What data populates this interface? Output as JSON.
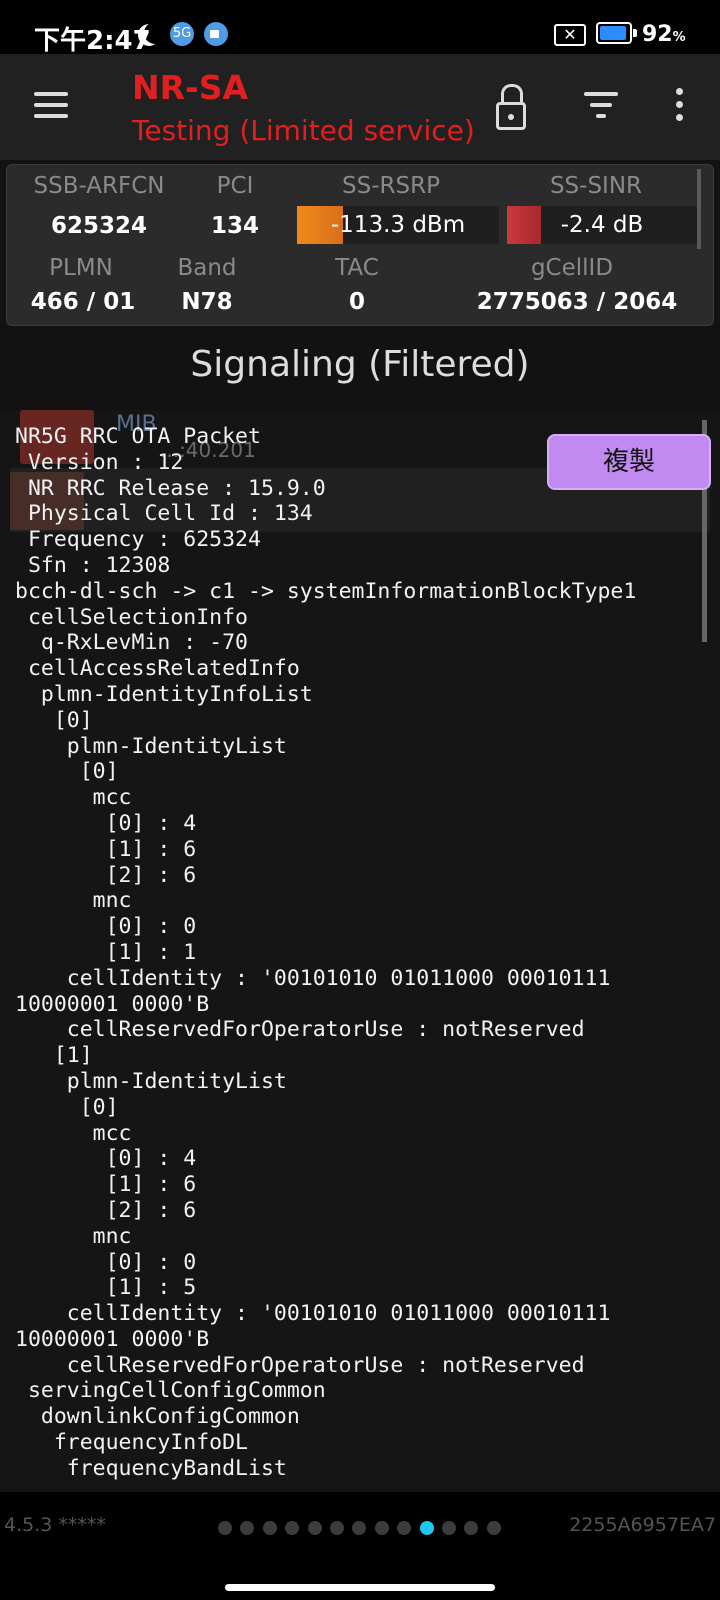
{
  "status_bar": {
    "time": "下午2:47",
    "battery_pct": "92",
    "battery_unit": "%",
    "wifi_badge": "5G"
  },
  "app_bar": {
    "title": "NR-SA",
    "subtitle": "Testing (Limited service)",
    "icons": [
      "menu-icon",
      "lock-icon",
      "filter-icon",
      "more-vert-icon"
    ],
    "accent_color": "#e11f1f"
  },
  "cell_info": {
    "labels": {
      "ssb_arfcn": "SSB-ARFCN",
      "pci": "PCI",
      "ss_rsrp": "SS-RSRP",
      "ss_sinr": "SS-SINR",
      "plmn": "PLMN",
      "band": "Band",
      "tac": "TAC",
      "gcellid": "gCellID"
    },
    "values": {
      "ssb_arfcn": "625324",
      "pci": "134",
      "ss_rsrp": "-113.3 dBm",
      "ss_sinr": "-2.4 dB",
      "plmn": "466 / 01",
      "band": "N78",
      "tac": "0",
      "gcellid": "2775063 / 2064"
    },
    "rsrp_bar_color": "#e8821e",
    "sinr_bar_color": "#c8343a"
  },
  "section_title": "Signaling (Filtered)",
  "background_list": {
    "mib_label": "MIB",
    "time_partial": "...:40.201"
  },
  "packet": {
    "lines": [
      "NR5G RRC OTA Packet",
      " Version : 12",
      " NR RRC Release : 15.9.0",
      " Physical Cell Id : 134",
      " Frequency : 625324",
      " Sfn : 12308",
      "bcch-dl-sch -> c1 -> systemInformationBlockType1",
      " cellSelectionInfo",
      "  q-RxLevMin : -70",
      " cellAccessRelatedInfo",
      "  plmn-IdentityInfoList",
      "   [0]",
      "    plmn-IdentityList",
      "     [0]",
      "      mcc",
      "       [0] : 4",
      "       [1] : 6",
      "       [2] : 6",
      "      mnc",
      "       [0] : 0",
      "       [1] : 1",
      "    cellIdentity : '00101010 01011000 00010111",
      "10000001 0000'B",
      "    cellReservedForOperatorUse : notReserved",
      "   [1]",
      "    plmn-IdentityList",
      "     [0]",
      "      mcc",
      "       [0] : 4",
      "       [1] : 6",
      "       [2] : 6",
      "      mnc",
      "       [0] : 0",
      "       [1] : 5",
      "    cellIdentity : '00101010 01011000 00010111",
      "10000001 0000'B",
      "    cellReservedForOperatorUse : notReserved",
      " servingCellConfigCommon",
      "  downlinkConfigCommon",
      "   frequencyInfoDL",
      "    frequencyBandList"
    ],
    "copy_label": "複製"
  },
  "footer": {
    "version": "4.5.3 *****",
    "device_id": "2255A6957EA7",
    "page_count": 13,
    "active_page_index": 9
  }
}
